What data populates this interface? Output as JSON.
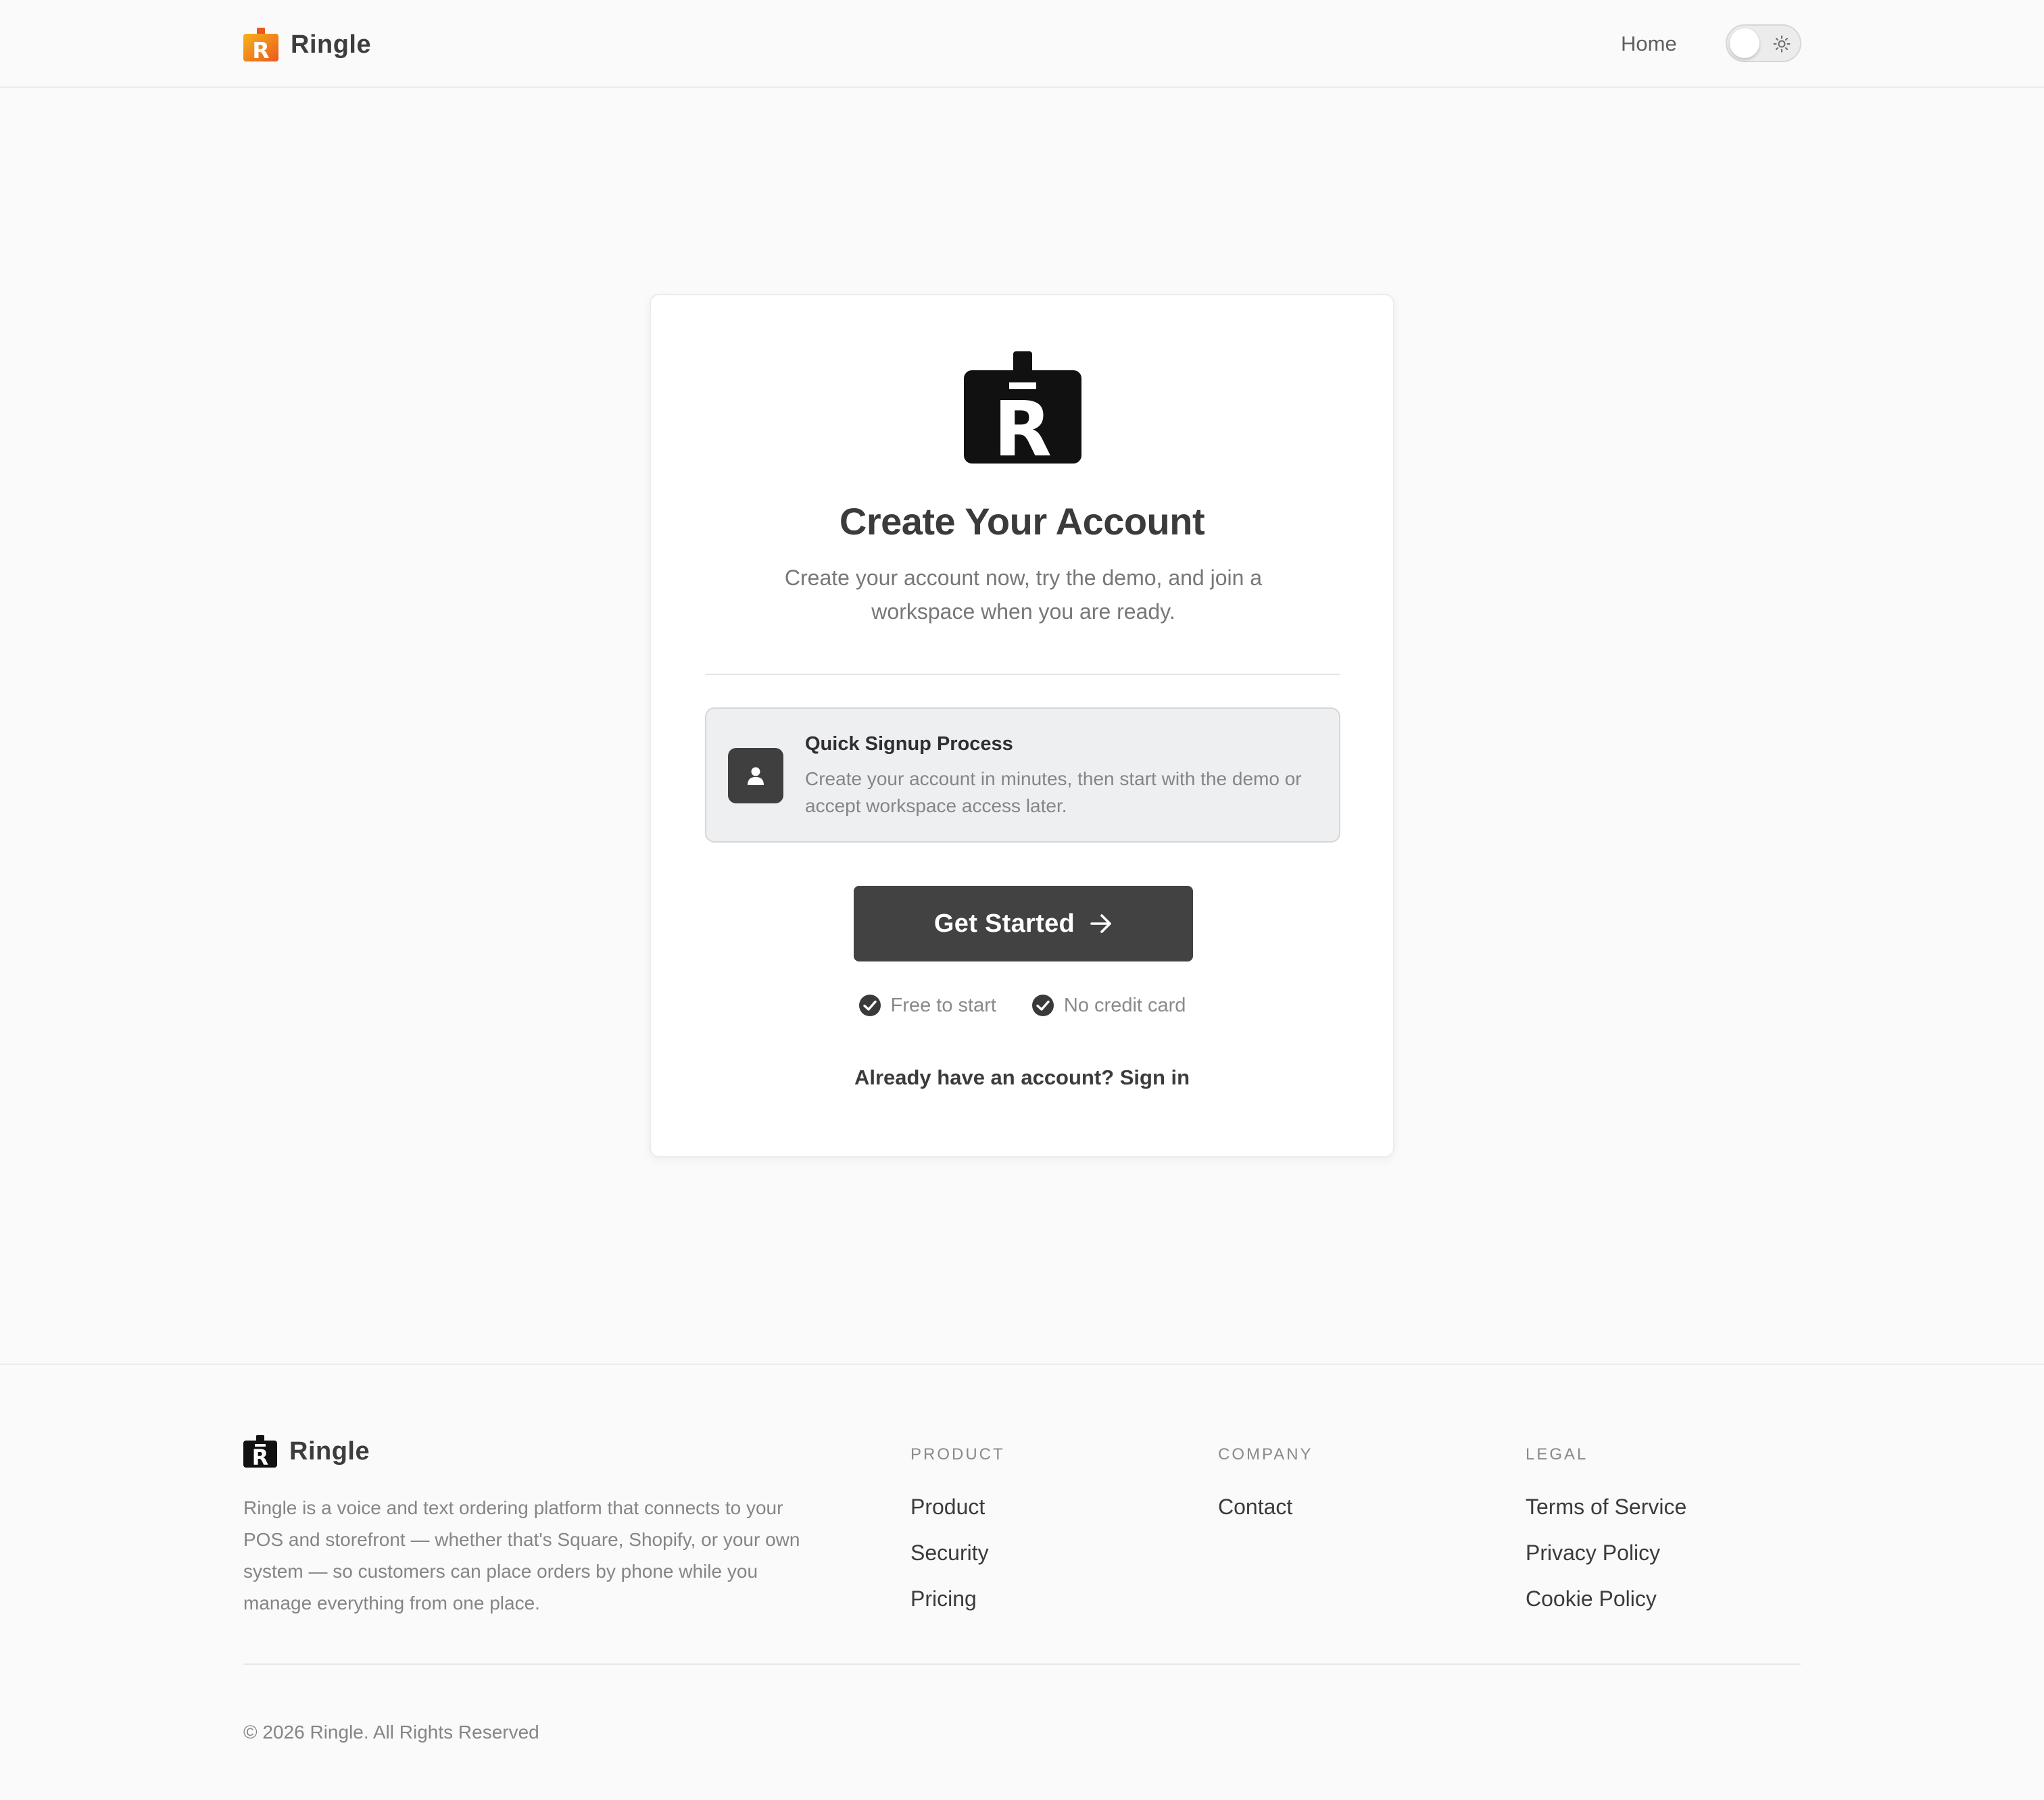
{
  "header": {
    "brand_name": "Ringle",
    "nav_home": "Home",
    "theme_toggle_icon": "sun-icon"
  },
  "card": {
    "logo_icon": "ringle-logo",
    "title": "Create Your Account",
    "subtitle": "Create your account now, try the demo, and join a workspace when you are ready.",
    "feature": {
      "icon": "user-icon",
      "title": "Quick Signup Process",
      "description": "Create your account in minutes, then start with the demo or accept workspace access later."
    },
    "cta_label": "Get Started",
    "cta_icon": "arrow-right-icon",
    "perks": [
      {
        "icon": "check-circle-icon",
        "label": "Free to start"
      },
      {
        "icon": "check-circle-icon",
        "label": "No credit card"
      }
    ],
    "signin_text": "Already have an account? Sign in"
  },
  "footer": {
    "brand_name": "Ringle",
    "description": "Ringle is a voice and text ordering platform that connects to your POS and storefront — whether that's Square, Shopify, or your own system — so customers can place orders by phone while you manage everything from one place.",
    "columns": [
      {
        "title": "PRODUCT",
        "links": [
          "Product",
          "Security",
          "Pricing"
        ]
      },
      {
        "title": "COMPANY",
        "links": [
          "Contact"
        ]
      },
      {
        "title": "LEGAL",
        "links": [
          "Terms of Service",
          "Privacy Policy",
          "Cookie Policy"
        ]
      }
    ],
    "copyright": "© 2026 Ringle. All Rights Reserved"
  },
  "colors": {
    "page_background": "#fafafa",
    "primary_button": "#424242",
    "brand_orange": "#f39c12",
    "brand_red": "#e8541c",
    "text_dark": "#3b3b3b",
    "text_muted": "#858585"
  }
}
